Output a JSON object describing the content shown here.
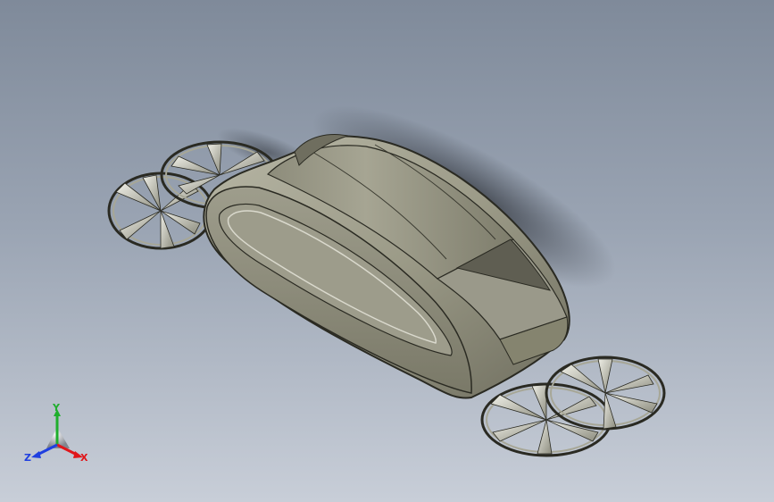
{
  "viewport": {
    "background_top": "#7f8a9a",
    "background_bottom": "#c8ced8",
    "model_color": "#8f8f80",
    "edge_color": "#2a2a22"
  },
  "triad": {
    "x_label": "X",
    "y_label": "Y",
    "z_label": "Z",
    "x_color": "#e0161a",
    "y_color": "#1fae2d",
    "z_color": "#1f3fe0"
  }
}
